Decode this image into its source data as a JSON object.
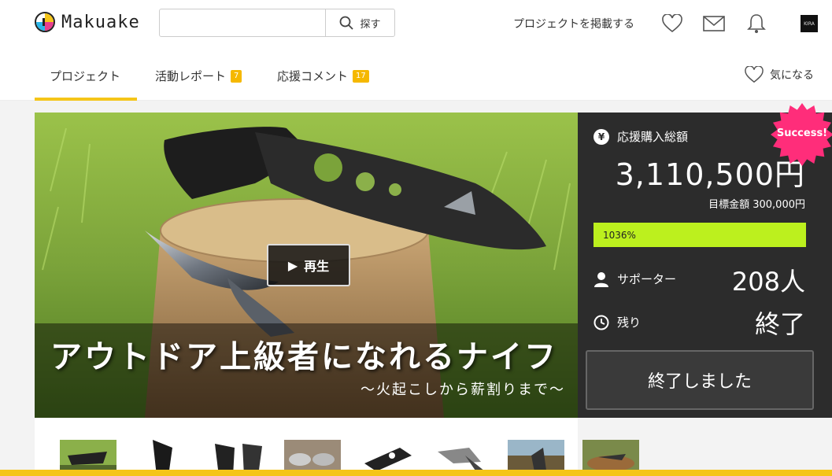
{
  "header": {
    "logo_text": "Makuake",
    "search_placeholder": "",
    "search_button": "探す",
    "post_project": "プロジェクトを掲載する",
    "avatar_text": "KIRA"
  },
  "tabs": [
    {
      "label": "プロジェクト",
      "badge": ""
    },
    {
      "label": "活動レポート",
      "badge": "7"
    },
    {
      "label": "応援コメント",
      "badge": "17"
    }
  ],
  "favorite_label": "気になる",
  "hero": {
    "play_label": "再生",
    "title": "アウトドア上級者になれるナイフ",
    "subtitle": "〜火起こしから薪割りまで〜"
  },
  "stats": {
    "total_label": "応援購入総額",
    "total_amount": "3,110,500円",
    "goal": "目標金額 300,000円",
    "progress_text": "1036%",
    "progress_fraction": 1.0,
    "supporters_label": "サポーター",
    "supporters_value": "208人",
    "remaining_label": "残り",
    "remaining_value": "終了",
    "ended_button": "終了しました",
    "success_badge": "Success!"
  },
  "colors": {
    "accent": "#f5c518",
    "badge": "#f5b800",
    "progress": "#bcf01e",
    "panel": "#2c2c2c",
    "success": "#ff2d7a"
  }
}
